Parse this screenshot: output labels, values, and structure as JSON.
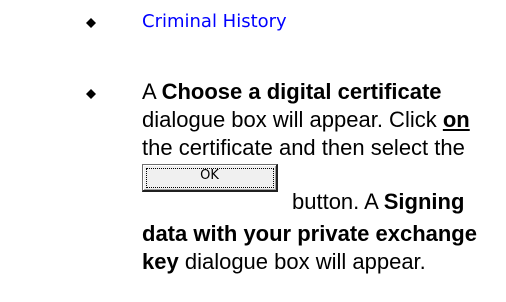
{
  "list": {
    "link_item": "Criminal History",
    "step": {
      "l1_pre": "A ",
      "l1_bold": "Choose a digital certificate",
      "l2_text": "dialogue box will appear.  Click ",
      "l2_bold_u": "on",
      "l3_text": "the certificate and then select the",
      "ok_label": "OK",
      "l4_text": "button.  A ",
      "l4_bold": "Signing",
      "l5_bold": "data with your private exchange",
      "l6_bold": "key",
      "l6_text": " dialogue box will appear."
    }
  },
  "icons": {
    "bullet": "diamond-bullet-icon"
  }
}
